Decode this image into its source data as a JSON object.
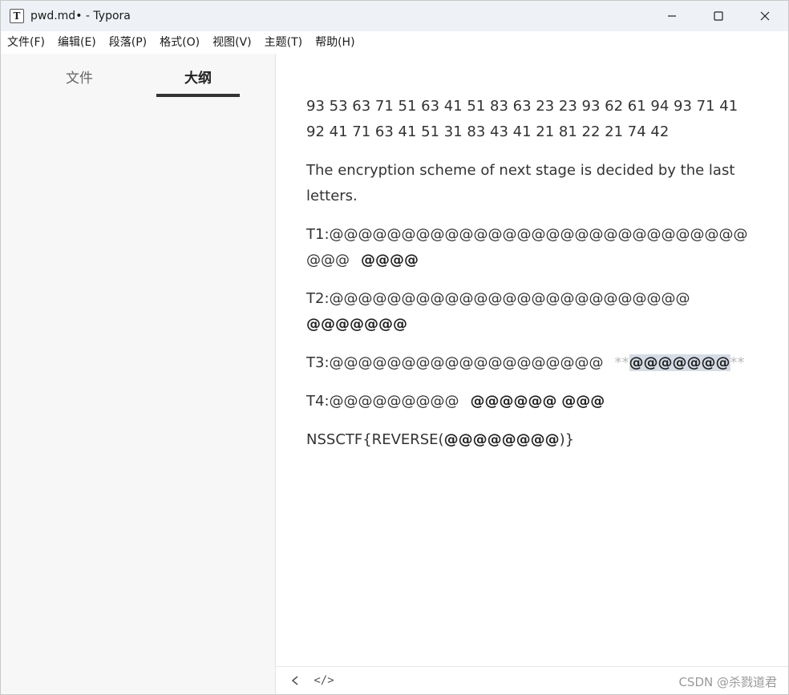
{
  "window": {
    "title": "pwd.md• - Typora",
    "app_icon_letter": "T"
  },
  "menubar": {
    "items": [
      "文件(F)",
      "编辑(E)",
      "段落(P)",
      "格式(O)",
      "视图(V)",
      "主题(T)",
      "帮助(H)"
    ]
  },
  "sidebar": {
    "tabs": [
      {
        "label": "文件",
        "active": false
      },
      {
        "label": "大纲",
        "active": true
      }
    ]
  },
  "document": {
    "numbers": "93 53 63 71 51 63 41 51 83 63 23 23 93 62 61 94 93 71 41 92 41 71 63 41 51 31 83 43 41 21 81 22 21 74 42",
    "scheme_text": "The encryption scheme of next stage is decided by the last letters.",
    "t1": {
      "plain": "T1:@@@@@@@@@@@@@@@@@@@@@@@@@@@@@@@@",
      "bold": "@@@@"
    },
    "t2": {
      "plain": "T2:@@@@@@@@@@@@@@@@@@@@@@@@@",
      "bold": "@@@@@@@"
    },
    "t3": {
      "plain": "T3:@@@@@@@@@@@@@@@@@@@",
      "marker_open": "**",
      "selected": "@@@@@@@",
      "marker_close": "**"
    },
    "t4": {
      "plain": "T4:@@@@@@@@@",
      "bold_a": "@@@@@@",
      "bold_b": "@@@"
    },
    "flag": {
      "prefix": "NSSCTF{REVERSE(",
      "bold": "@@@@@@@@",
      "suffix": ")}"
    }
  },
  "statusbar": {
    "back_icon": "chevron-left-icon",
    "source_icon": "code-icon",
    "source_label": "</>",
    "watermark": "CSDN @杀戮道君"
  },
  "colors": {
    "titlebar_bg": "#eef1f5",
    "sidebar_bg": "#f7f7f7",
    "text": "#333333",
    "selection": "#d6dce6"
  }
}
